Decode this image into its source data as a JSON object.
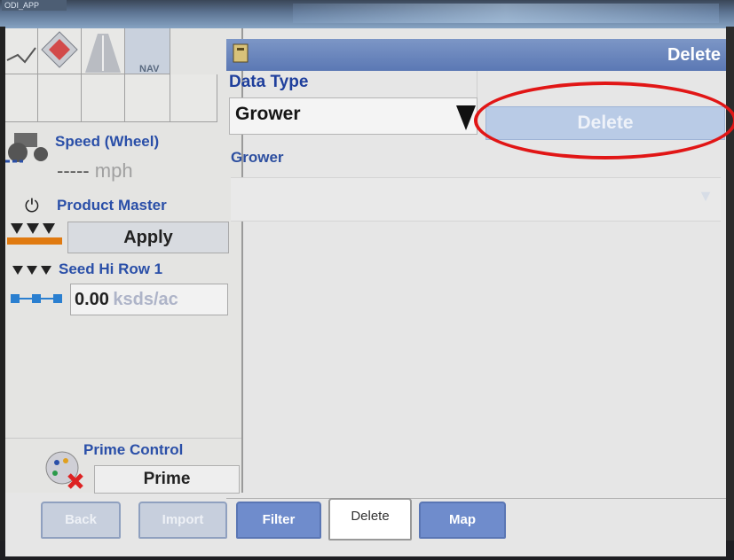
{
  "window": {
    "title": "ODI_APP"
  },
  "sidebar": {
    "icons": [
      {
        "name": "field-boundary-icon"
      },
      {
        "name": "compass-icon"
      },
      {
        "name": "road-guidance-icon"
      },
      {
        "name": "nav-icon",
        "label": "NAV"
      }
    ],
    "speed": {
      "title": "Speed (Wheel)",
      "value": "-----",
      "unit": "mph",
      "icon": "tractor-icon"
    },
    "product_master": {
      "title": "Product Master",
      "button": "Apply",
      "icon": "power-icon"
    },
    "seed": {
      "title": "Seed Hi Row 1",
      "value": "0.00",
      "unit": "ksds/ac",
      "icon": "planter-row-icon"
    },
    "prime_control": {
      "title": "Prime Control",
      "button": "Prime",
      "icon": "prime-icon"
    }
  },
  "main": {
    "header_title": "Delete",
    "data_type_label": "Data Type",
    "data_type_value": "Grower",
    "delete_button": "Delete",
    "grower_label": "Grower",
    "grower_value": ""
  },
  "tabs": [
    {
      "label": "Back",
      "state": "disabled"
    },
    {
      "label": "Import",
      "state": "disabled"
    },
    {
      "label": "Filter",
      "state": "enabled"
    },
    {
      "label": "Delete",
      "state": "active"
    },
    {
      "label": "Map",
      "state": "enabled"
    }
  ],
  "colors": {
    "accent_blue": "#2a4fa8",
    "header_blue": "#5b78b4",
    "annotation_red": "#e11616"
  }
}
